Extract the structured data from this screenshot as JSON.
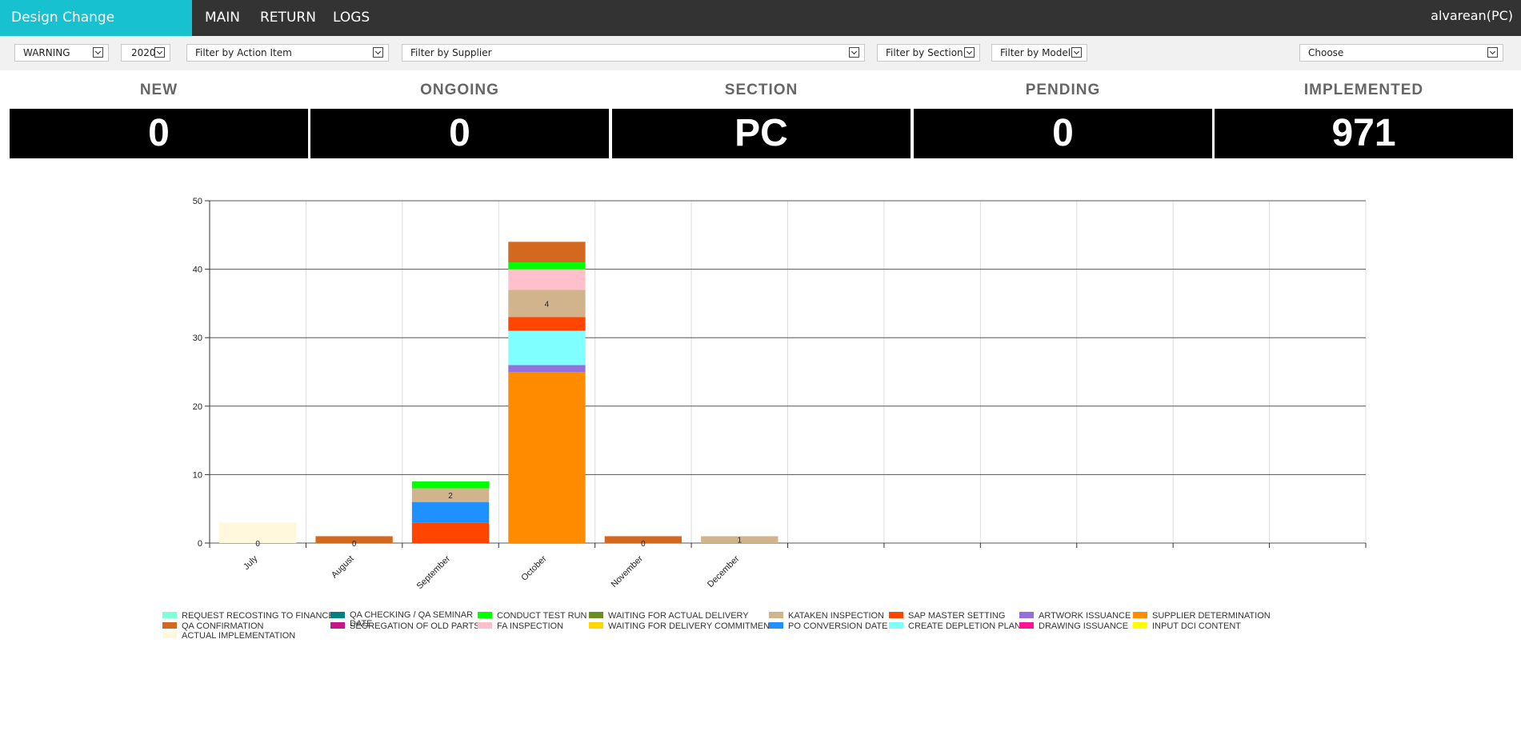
{
  "header": {
    "brand": "Design Change Information",
    "nav": [
      "MAIN",
      "RETURN",
      "LOGS"
    ],
    "user": "alvarean(PC)"
  },
  "filters": {
    "status": "WARNING",
    "year": "2020",
    "action_item": "Filter by Action Item",
    "supplier": "Filter by Supplier",
    "section": "Filter by Section",
    "model": "Filter by Model",
    "choose": "Choose"
  },
  "stats": [
    {
      "label": "NEW",
      "value": "0"
    },
    {
      "label": "ONGOING",
      "value": "0"
    },
    {
      "label": "SECTION",
      "value": "PC"
    },
    {
      "label": "PENDING",
      "value": "0"
    },
    {
      "label": "IMPLEMENTED",
      "value": "971"
    }
  ],
  "colors": {
    "brand": "#17c1cf",
    "topbar": "#333333",
    "stat_box": "#000000"
  },
  "chart_data": {
    "type": "bar",
    "stacked": true,
    "categories": [
      "July",
      "August",
      "September",
      "October",
      "November",
      "December",
      "",
      "",
      "",
      "",
      "",
      ""
    ],
    "ylim": [
      0,
      50
    ],
    "yticks": [
      0,
      10,
      20,
      30,
      40,
      50
    ],
    "grid": true,
    "legend_position": "bottom",
    "series": [
      {
        "name": "REQUEST RECOSTING TO FINANCE",
        "color": "#7fffd4",
        "values": [
          0,
          0,
          0,
          0,
          0,
          0,
          0,
          0,
          0,
          0,
          0,
          0
        ]
      },
      {
        "name": "QA CHECKING / QA SEMINAR DATE",
        "color": "#008080",
        "values": [
          0,
          0,
          0,
          0,
          0,
          0,
          0,
          0,
          0,
          0,
          0,
          0
        ]
      },
      {
        "name": "CONDUCT TEST RUN",
        "color": "#00ff00",
        "values": [
          0,
          0,
          1,
          1,
          0,
          0,
          0,
          0,
          0,
          0,
          0,
          0
        ]
      },
      {
        "name": "WAITING FOR ACTUAL DELIVERY",
        "color": "#6b8e23",
        "values": [
          0,
          0,
          0,
          0,
          0,
          0,
          0,
          0,
          0,
          0,
          0,
          0
        ]
      },
      {
        "name": "KATAKEN INSPECTION",
        "color": "#d2b48c",
        "values": [
          0,
          0,
          2,
          4,
          0,
          1,
          0,
          0,
          0,
          0,
          0,
          0
        ]
      },
      {
        "name": "SAP MASTER SETTING",
        "color": "#ff4500",
        "values": [
          0,
          0,
          3,
          2,
          0,
          0,
          0,
          0,
          0,
          0,
          0,
          0
        ]
      },
      {
        "name": "ARTWORK ISSUANCE",
        "color": "#9370db",
        "values": [
          0,
          0,
          0,
          1,
          0,
          0,
          0,
          0,
          0,
          0,
          0,
          0
        ]
      },
      {
        "name": "SUPPLIER DETERMINATION",
        "color": "#ff8c00",
        "values": [
          0,
          0,
          0,
          25,
          0,
          0,
          0,
          0,
          0,
          0,
          0,
          0
        ]
      },
      {
        "name": "QA CONFIRMATION",
        "color": "#d2691e",
        "values": [
          0,
          1,
          0,
          3,
          1,
          0,
          0,
          0,
          0,
          0,
          0,
          0
        ]
      },
      {
        "name": "SEGREGATION OF OLD PARTS",
        "color": "#c71585",
        "values": [
          0,
          0,
          0,
          0,
          0,
          0,
          0,
          0,
          0,
          0,
          0,
          0
        ]
      },
      {
        "name": "FA INSPECTION",
        "color": "#ffc0cb",
        "values": [
          0,
          0,
          0,
          3,
          0,
          0,
          0,
          0,
          0,
          0,
          0,
          0
        ]
      },
      {
        "name": "WAITING FOR DELIVERY COMMITMENT",
        "color": "#ffd700",
        "values": [
          0,
          0,
          0,
          0,
          0,
          0,
          0,
          0,
          0,
          0,
          0,
          0
        ]
      },
      {
        "name": "PO CONVERSION DATE",
        "color": "#1e90ff",
        "values": [
          0,
          0,
          3,
          0,
          0,
          0,
          0,
          0,
          0,
          0,
          0,
          0
        ]
      },
      {
        "name": "CREATE DEPLETION PLAN",
        "color": "#7fffff",
        "values": [
          0,
          0,
          0,
          5,
          0,
          0,
          0,
          0,
          0,
          0,
          0,
          0
        ]
      },
      {
        "name": "DRAWING ISSUANCE",
        "color": "#ff1493",
        "values": [
          0,
          0,
          0,
          0,
          0,
          0,
          0,
          0,
          0,
          0,
          0,
          0
        ]
      },
      {
        "name": "INPUT DCI CONTENT",
        "color": "#ffff00",
        "values": [
          0,
          0,
          0,
          0,
          0,
          0,
          0,
          0,
          0,
          0,
          0,
          0
        ]
      },
      {
        "name": "ACTUAL IMPLEMENTATION",
        "color": "#fff8dc",
        "values": [
          3,
          0,
          0,
          0,
          0,
          0,
          0,
          0,
          0,
          0,
          0,
          0
        ]
      }
    ],
    "stack_order": [
      "SUPPLIER DETERMINATION",
      "ARTWORK ISSUANCE",
      "CREATE DEPLETION PLAN",
      "SAP MASTER SETTING",
      "PO CONVERSION DATE",
      "KATAKEN INSPECTION",
      "FA INSPECTION",
      "CONDUCT TEST RUN",
      "QA CONFIRMATION",
      "ACTUAL IMPLEMENTATION"
    ],
    "bar_labels": [
      {
        "category": "July",
        "y": 0,
        "text": "0"
      },
      {
        "category": "August",
        "y": 0,
        "text": "0"
      },
      {
        "category": "September",
        "y": 7,
        "text": "2"
      },
      {
        "category": "October",
        "y": 35,
        "text": "4"
      },
      {
        "category": "November",
        "y": 0,
        "text": "0"
      },
      {
        "category": "December",
        "y": 0.5,
        "text": "1"
      }
    ]
  }
}
